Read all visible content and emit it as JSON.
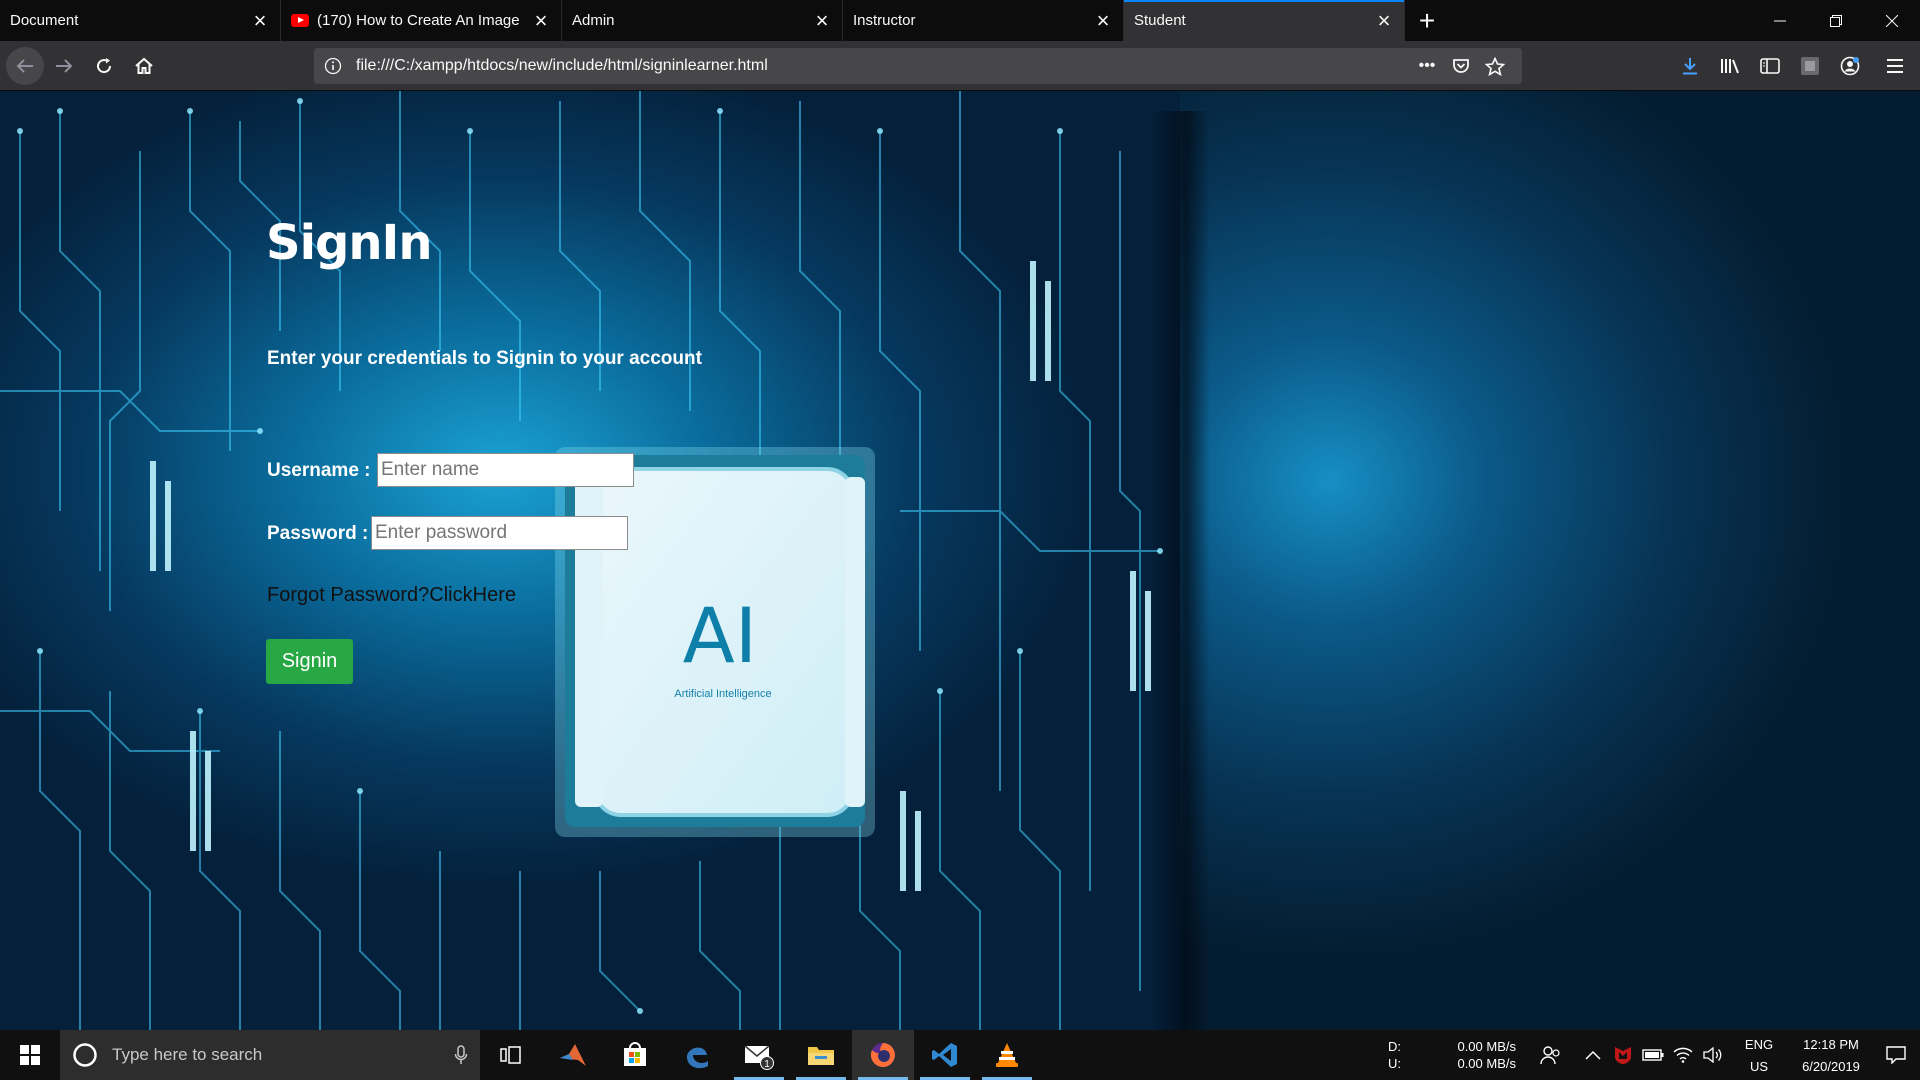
{
  "browser": {
    "tabs": [
      {
        "title": "Document",
        "active": false,
        "has_favicon": false
      },
      {
        "title": "(170) How to Create An Image",
        "active": false,
        "has_favicon": true,
        "favicon": "youtube-icon"
      },
      {
        "title": "Admin",
        "active": false,
        "has_favicon": false
      },
      {
        "title": "Instructor",
        "active": false,
        "has_favicon": false
      },
      {
        "title": "Student",
        "active": true,
        "has_favicon": false
      }
    ],
    "url": "file:///C:/xampp/htdocs/new/include/html/signinlearner.html",
    "accent_color": "#0a84ff"
  },
  "page": {
    "title": "SignIn",
    "subtitle": "Enter your credentials to Signin to your account",
    "username_label": "Username :",
    "username_placeholder": "Enter name",
    "password_label": "Password :",
    "password_placeholder": "Enter password",
    "forgot_link": "Forgot Password?ClickHere",
    "signin_button": "Signin",
    "signin_button_color": "#28a745",
    "chip_text": "AI",
    "chip_caption": "Artificial Intelligence"
  },
  "taskbar": {
    "search_placeholder": "Type here to search",
    "mail_badge": "1",
    "net_down_label": "D:",
    "net_up_label": "U:",
    "net_down": "0.00 MB/s",
    "net_up": "0.00 MB/s",
    "lang": "ENG",
    "region": "US",
    "time": "12:18 PM",
    "date": "6/20/2019"
  }
}
